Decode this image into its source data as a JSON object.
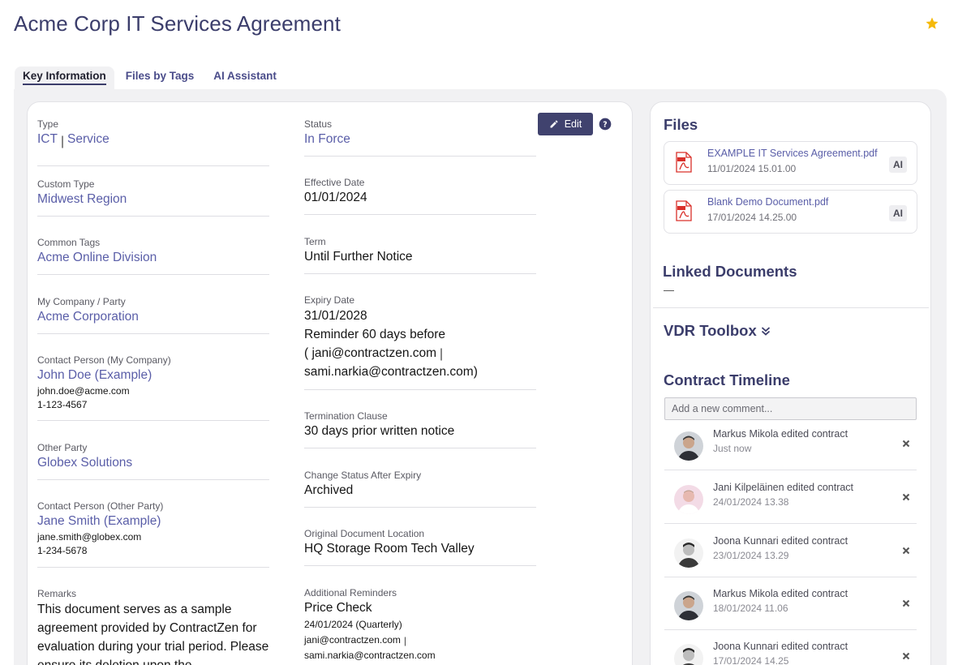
{
  "page": {
    "title": "Acme Corp IT Services Agreement"
  },
  "tabs": [
    {
      "label": "Key Information"
    },
    {
      "label": "Files by Tags"
    },
    {
      "label": "AI Assistant"
    }
  ],
  "edit_label": "Edit",
  "left_fields": {
    "type_label": "Type",
    "type_value_1": "ICT",
    "type_sep": "|",
    "type_value_2": "Service",
    "custom_type_label": "Custom Type",
    "custom_type_value": "Midwest Region",
    "common_tags_label": "Common Tags",
    "common_tags_value": "Acme Online Division",
    "my_company_label": "My Company / Party",
    "my_company_value": "Acme Corporation",
    "contact_my_label": "Contact Person (My Company)",
    "contact_my_name": "John Doe (Example)",
    "contact_my_email": "john.doe@acme.com",
    "contact_my_phone": "1-123-4567",
    "other_party_label": "Other Party",
    "other_party_value": "Globex Solutions",
    "contact_other_label": "Contact Person (Other Party)",
    "contact_other_name": "Jane Smith (Example)",
    "contact_other_email": "jane.smith@globex.com",
    "contact_other_phone": "1-234-5678",
    "remarks_label": "Remarks",
    "remarks_value": "This document serves as a sample agreement provided by ContractZen for evaluation during your trial period. Please ensure its deletion upon the"
  },
  "right_fields": {
    "status_label": "Status",
    "status_value": "In Force",
    "effective_label": "Effective Date",
    "effective_value": "01/01/2024",
    "term_label": "Term",
    "term_value": "Until Further Notice",
    "expiry_label": "Expiry Date",
    "expiry_value": "31/01/2028",
    "expiry_reminder": "Reminder 60 days before",
    "expiry_emails_1": "( jani@contractzen.com",
    "expiry_emails_sep": "|",
    "expiry_emails_2": "sami.narkia@contractzen.com)",
    "termination_label": "Termination Clause",
    "termination_value": "30 days prior written notice",
    "change_status_label": "Change Status After Expiry",
    "change_status_value": "Archived",
    "location_label": "Original Document Location",
    "location_value": "HQ Storage Room Tech Valley",
    "additional_label": "Additional Reminders",
    "additional_value": "Price Check",
    "additional_date": "24/01/2024 (Quarterly)",
    "additional_email_1": "jani@contractzen.com",
    "additional_sep": "|",
    "additional_email_2": "sami.narkia@contractzen.com"
  },
  "files": {
    "title": "Files",
    "items": [
      {
        "name": "EXAMPLE IT Services Agreement.pdf",
        "date": "11/01/2024 15.01.00",
        "badge": "AI"
      },
      {
        "name": "Blank Demo Document.pdf",
        "date": "17/01/2024 14.25.00",
        "badge": "AI"
      }
    ]
  },
  "linked": {
    "title": "Linked Documents",
    "empty": "—"
  },
  "vdr": {
    "title": "VDR Toolbox"
  },
  "timeline": {
    "title": "Contract Timeline",
    "placeholder": "Add a new comment...",
    "items": [
      {
        "text": "Markus Mikola edited contract",
        "time": "Just now"
      },
      {
        "text": "Jani Kilpeläinen edited contract",
        "time": "24/01/2024 13.38"
      },
      {
        "text": "Joona Kunnari edited contract",
        "time": "23/01/2024 13.29"
      },
      {
        "text": "Markus Mikola edited contract",
        "time": "18/01/2024 11.06"
      },
      {
        "text": "Joona Kunnari edited contract",
        "time": "17/01/2024 14.25"
      }
    ]
  },
  "colors": {
    "accent": "#3b3d6b",
    "link": "#5a5ea8",
    "star": "#f5b90a",
    "pdf": "#d9302a"
  }
}
